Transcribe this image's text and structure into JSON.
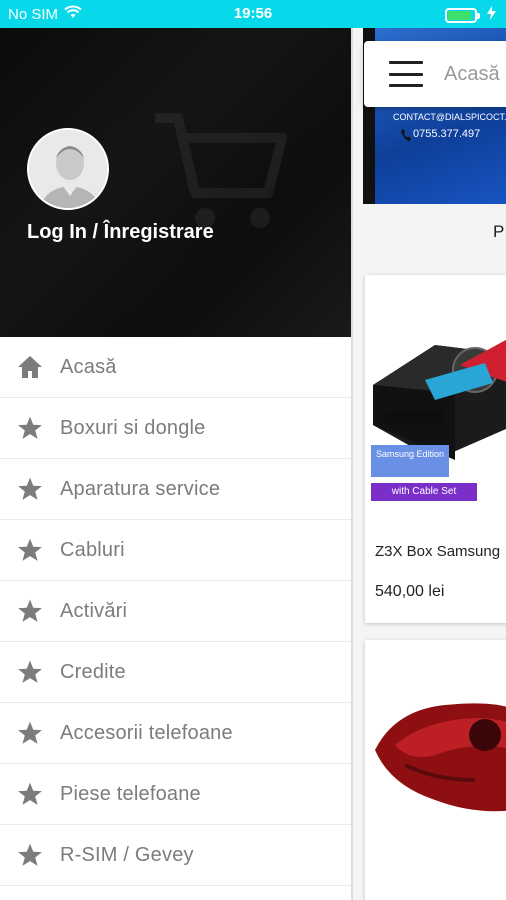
{
  "status_bar": {
    "carrier": "No SIM",
    "time": "19:56",
    "battery_level": 0.9
  },
  "drawer": {
    "login_label": "Log In / Înregistrare",
    "menu_items": [
      {
        "label": "Acasă",
        "icon": "home-icon"
      },
      {
        "label": "Boxuri si dongle",
        "icon": "star-icon"
      },
      {
        "label": "Aparatura service",
        "icon": "star-icon"
      },
      {
        "label": "Cabluri",
        "icon": "star-icon"
      },
      {
        "label": "Activări",
        "icon": "star-icon"
      },
      {
        "label": "Credite",
        "icon": "star-icon"
      },
      {
        "label": "Accesorii telefoane",
        "icon": "star-icon"
      },
      {
        "label": "Piese telefoane",
        "icon": "star-icon"
      },
      {
        "label": "R-SIM / Gevey",
        "icon": "star-icon"
      }
    ]
  },
  "main": {
    "appbar_title": "Acasă",
    "banner": {
      "contact": "CONTACT@DIALSPICOCT.RO",
      "phone": "0755.377.497"
    },
    "section_label_partial": "P",
    "products": [
      {
        "title": "Z3X Box Samsung",
        "price": "540,00 lei",
        "badge_edition": "Samsung Edition",
        "badge_cable": "with Cable Set"
      },
      {
        "title": "",
        "price": ""
      }
    ]
  },
  "colors": {
    "status_bar": "#08d9ea",
    "drawer_header": "#0d0d0d",
    "menu_text": "#7c7c7c",
    "menu_icon": "#7c7c7c",
    "badge_blue": "#6a90e6",
    "badge_purple": "#7b2fc9"
  }
}
